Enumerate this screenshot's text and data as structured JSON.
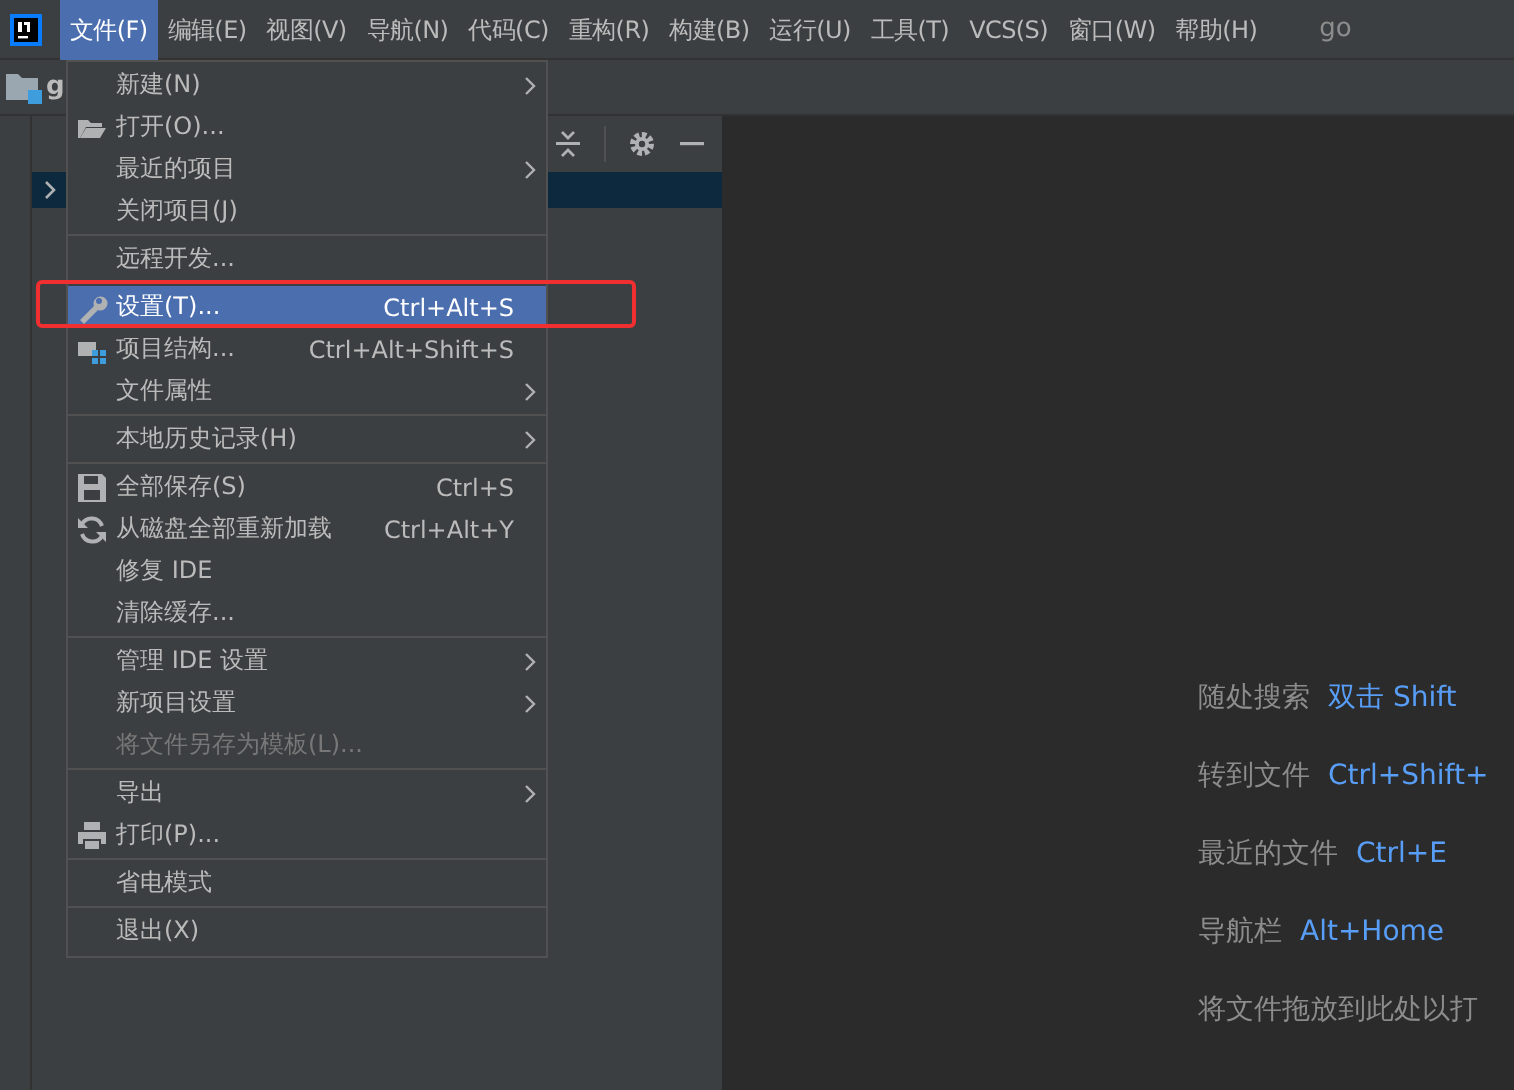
{
  "menubar": {
    "items": [
      {
        "label": "文件(F)",
        "selected": true
      },
      {
        "label": "编辑(E)",
        "selected": false
      },
      {
        "label": "视图(V)",
        "selected": false
      },
      {
        "label": "导航(N)",
        "selected": false
      },
      {
        "label": "代码(C)",
        "selected": false
      },
      {
        "label": "重构(R)",
        "selected": false
      },
      {
        "label": "构建(B)",
        "selected": false
      },
      {
        "label": "运行(U)",
        "selected": false
      },
      {
        "label": "工具(T)",
        "selected": false
      },
      {
        "label": "VCS(S)",
        "selected": false
      },
      {
        "label": "窗口(W)",
        "selected": false
      },
      {
        "label": "帮助(H)",
        "selected": false
      }
    ],
    "project_title": "go"
  },
  "navbar": {
    "project": "g"
  },
  "menu": {
    "groups": [
      [
        {
          "label": "新建(N)",
          "submenu": true
        },
        {
          "label": "打开(O)...",
          "kind": "folder"
        },
        {
          "label": "最近的项目",
          "submenu": true
        },
        {
          "label": "关闭项目(J)"
        }
      ],
      [
        {
          "label": "远程开发..."
        }
      ],
      [
        {
          "label": "设置(T)...",
          "shortcut": "Ctrl+Alt+S",
          "kind": "wrench",
          "selected": true,
          "annotated": true
        },
        {
          "label": "项目结构...",
          "shortcut": "Ctrl+Alt+Shift+S",
          "kind": "structure",
          "selected": false
        },
        {
          "label": "文件属性",
          "submenu": true,
          "selected": false
        }
      ],
      [
        {
          "label": "本地历史记录(H)",
          "submenu": true
        }
      ],
      [
        {
          "label": "全部保存(S)",
          "shortcut": "Ctrl+S",
          "kind": "save"
        },
        {
          "label": "从磁盘全部重新加载",
          "shortcut": "Ctrl+Alt+Y",
          "kind": "reload"
        },
        {
          "label": "修复 IDE"
        },
        {
          "label": "清除缓存..."
        }
      ],
      [
        {
          "label": "管理 IDE 设置",
          "submenu": true
        },
        {
          "label": "新项目设置",
          "submenu": true
        },
        {
          "label": "将文件另存为模板(L)...",
          "disabled": true
        }
      ],
      [
        {
          "label": "导出",
          "submenu": true
        },
        {
          "label": "打印(P)...",
          "kind": "print"
        }
      ],
      [
        {
          "label": "省电模式"
        }
      ],
      [
        {
          "label": "退出(X)"
        }
      ]
    ]
  },
  "hints": [
    {
      "label": "随处搜索",
      "shortcut": "双击 Shift"
    },
    {
      "label": "转到文件",
      "shortcut": "Ctrl+Shift+"
    },
    {
      "label": "最近的文件",
      "shortcut": "Ctrl+E"
    },
    {
      "label": "导航栏",
      "shortcut": "Alt+Home"
    },
    {
      "label": "将文件拖放到此处以打"
    }
  ]
}
